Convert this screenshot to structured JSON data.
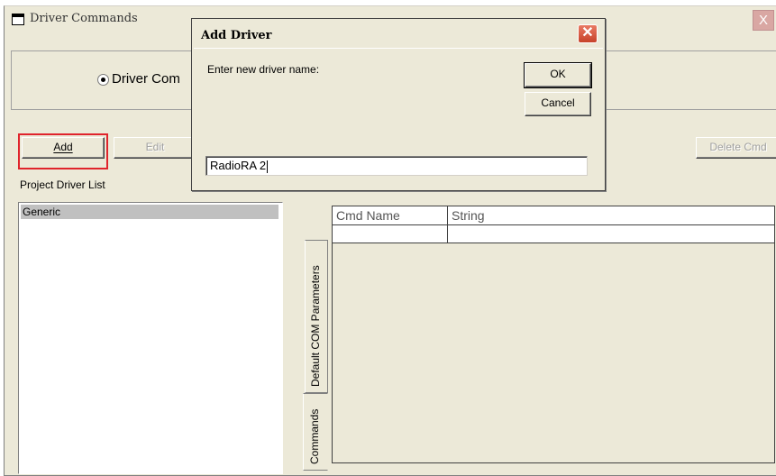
{
  "window": {
    "title": "Driver Commands",
    "close_glyph": "X"
  },
  "mode": {
    "radio_label": "Driver Com"
  },
  "toolbar": {
    "add_label": "Add",
    "edit_label": "Edit",
    "delete_cmd_label": "Delete Cmd"
  },
  "project_driver_list": {
    "label": "Project Driver List",
    "items": [
      "Generic"
    ]
  },
  "tabs": {
    "com_params": "Default COM Parameters",
    "commands": "Commands"
  },
  "commands_grid": {
    "columns": [
      "Cmd Name",
      "String"
    ]
  },
  "dialog": {
    "title": "Add Driver",
    "close_glyph": "✕",
    "prompt": "Enter new driver name:",
    "ok_label": "OK",
    "cancel_label": "Cancel",
    "input_value": "RadioRA 2"
  },
  "colors": {
    "highlight": "#e0242c",
    "window_bg": "#ece9d8",
    "list_selected": "#c0c0c0"
  }
}
